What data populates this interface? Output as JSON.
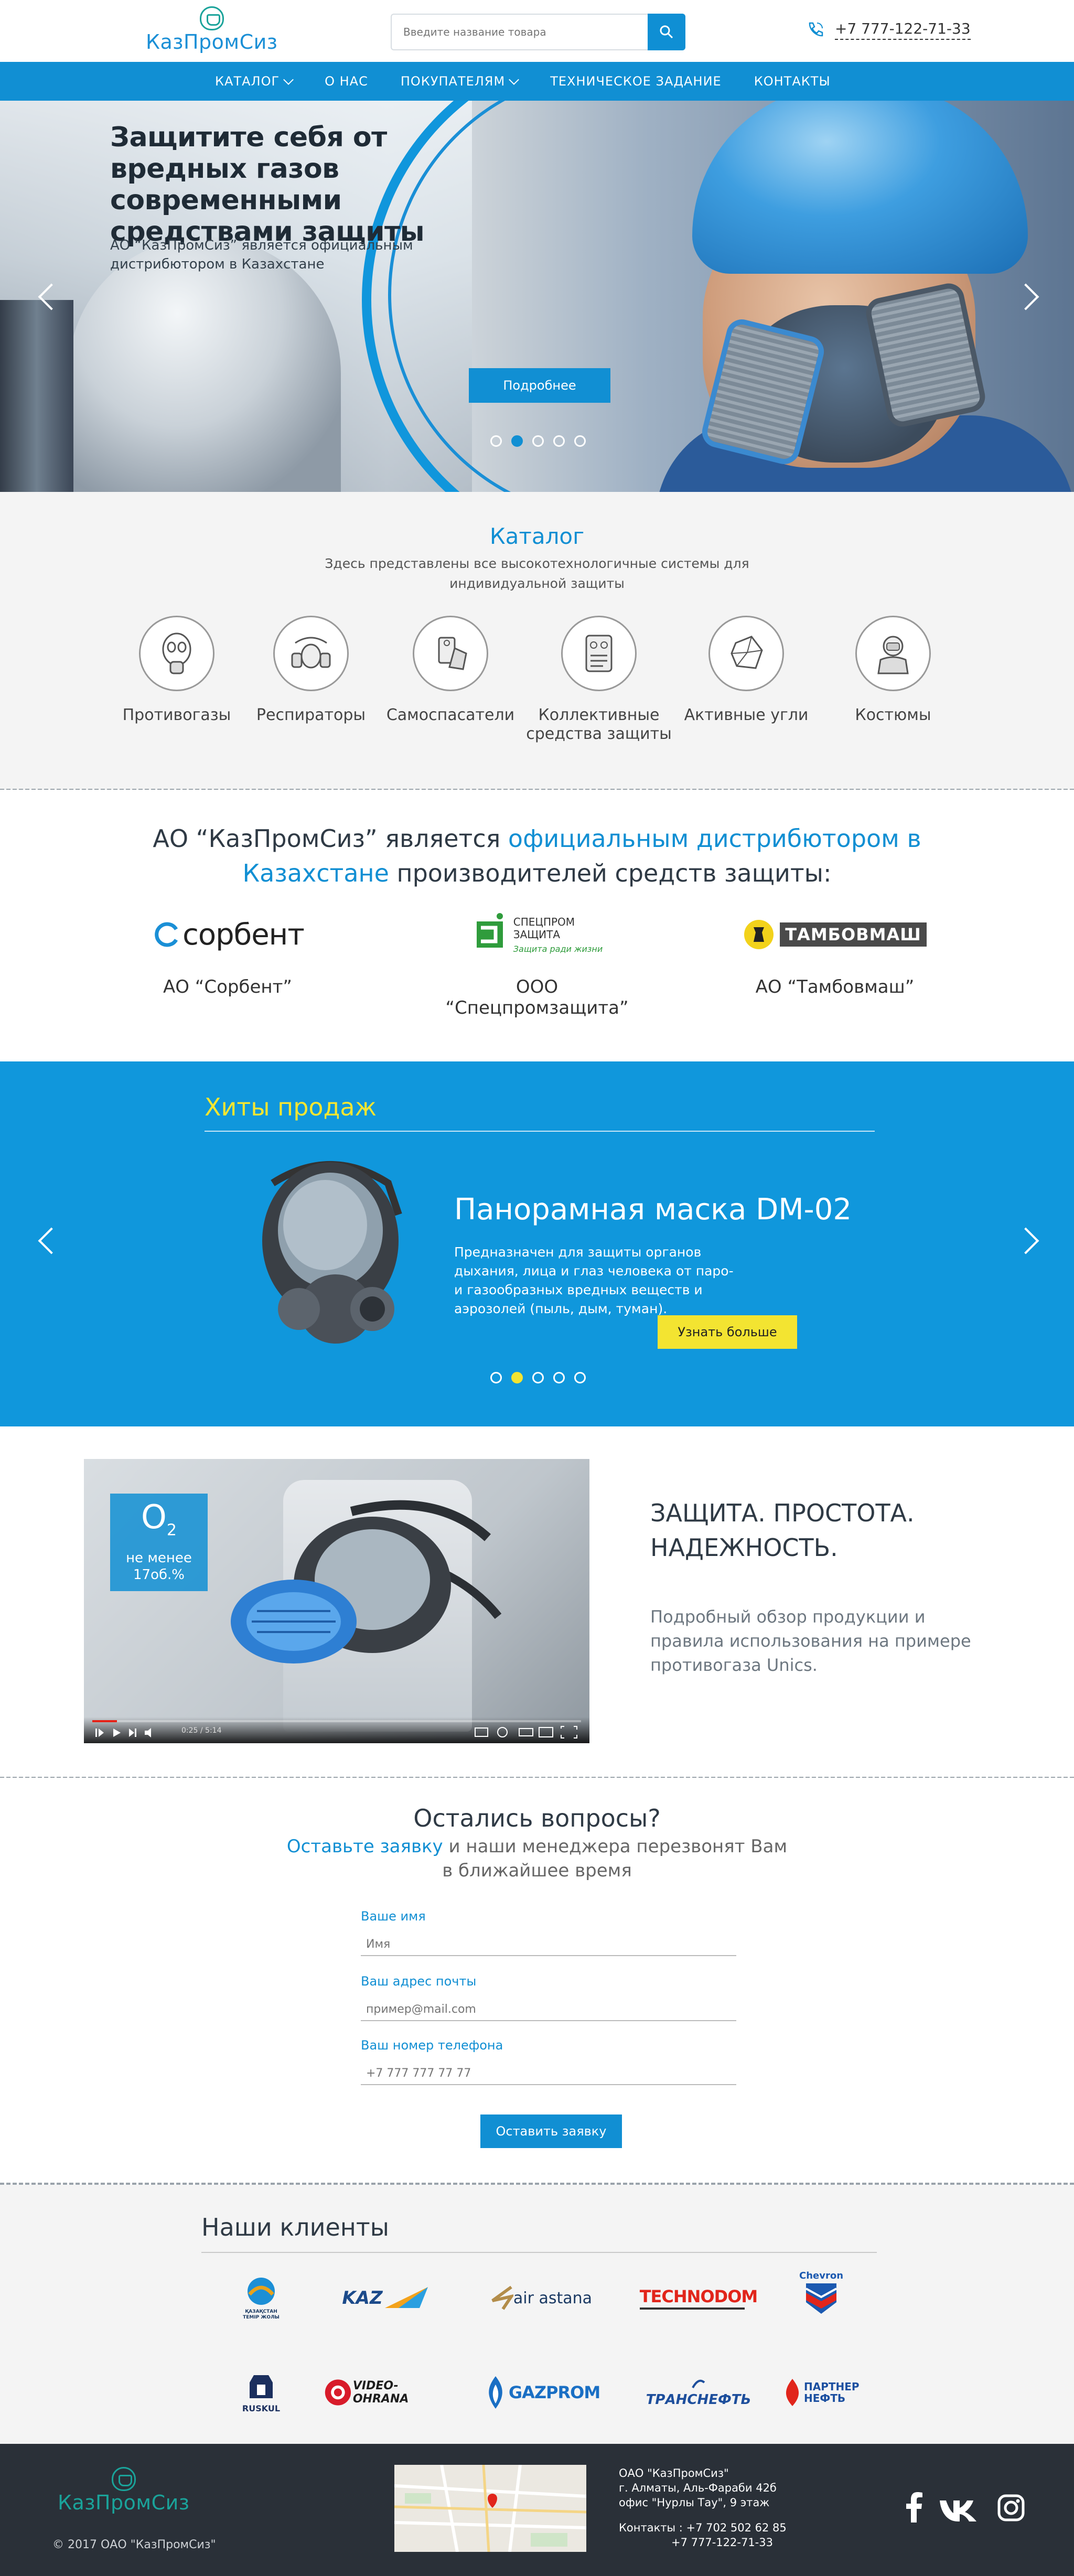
{
  "header": {
    "logo_text": "КазПромСиз",
    "search_placeholder": "Введите название товара",
    "phone": "+7 777-122-71-33"
  },
  "nav": {
    "items": [
      {
        "label": "КАТАЛОГ",
        "has_dropdown": true
      },
      {
        "label": "О НАС",
        "has_dropdown": false
      },
      {
        "label": "ПОКУПАТЕЛЯМ",
        "has_dropdown": true
      },
      {
        "label": "ТЕХНИЧЕСКОЕ ЗАДАНИЕ",
        "has_dropdown": false
      },
      {
        "label": "КОНТАКТЫ",
        "has_dropdown": false
      }
    ]
  },
  "hero": {
    "title": "Защитите себя от вредных газов современными средствами защиты",
    "subtitle": "АО “КазПромСиз” является официальным дистрибютором в Казахстане",
    "button": "Подробнее",
    "active_slide": 2,
    "slide_count": 5
  },
  "catalog": {
    "title": "Каталог",
    "subtitle": "Здесь представлены все высокотехнологичные системы для индивидуальной защиты",
    "items": [
      {
        "label": "Противогазы",
        "icon": "gas-mask-icon"
      },
      {
        "label": "Респираторы",
        "icon": "respirator-icon"
      },
      {
        "label": "Самоспасатели",
        "icon": "self-rescuer-icon"
      },
      {
        "label": "Коллективные средства защиты",
        "icon": "collective-protection-icon"
      },
      {
        "label": "Активные угли",
        "icon": "activated-carbon-icon"
      },
      {
        "label": "Костюмы",
        "icon": "suit-icon"
      }
    ]
  },
  "distributor": {
    "title_part1": "АО “КазПромСиз” является ",
    "title_highlight": "официальным дистрибютором в Казахстане",
    "title_part2": " производителей средств защиты:",
    "brands": [
      {
        "label": "АО “Сорбент”",
        "logo_text": "сорбент"
      },
      {
        "label": "ООО “Спецпромзащита”",
        "logo_text": "СПЕЦПРОМ ЗАЩИТА",
        "logo_sub": "Защита ради жизни"
      },
      {
        "label": "АО “Тамбовмаш”",
        "logo_text": "ТАМБОВМАШ"
      }
    ]
  },
  "hits": {
    "title": "Хиты продаж",
    "product_title": "Панорамная маска DM-02",
    "product_desc": "Предназначен для защиты органов дыхания, лица и глаз человека от паро- и газообразных вредных веществ и аэрозолей (пыль, дым, туман).",
    "button": "Узнать больше",
    "active_slide": 2,
    "slide_count": 5
  },
  "video": {
    "badge_o2": "O",
    "badge_sub": "2",
    "badge_line1": "не менее",
    "badge_line2": "17об.%",
    "time": "0:25 / 5:14",
    "heading_line1": "ЗАЩИТА. ПРОСТОТА.",
    "heading_line2": "НАДЕЖНОСТЬ.",
    "description": "Подробный обзор продукции и правила использования на примере противогаза Unics."
  },
  "form": {
    "title": "Остались вопросы?",
    "sub_link": "Оставьте заявку",
    "sub_rest": " и наши менеджера перезвонят Вам",
    "sub_line2": "в ближайшее время",
    "fields": [
      {
        "label": "Ваше имя",
        "placeholder": "Имя"
      },
      {
        "label": "Ваш адрес почты",
        "placeholder": "пример@mail.com"
      },
      {
        "label": "Ваш номер телефона",
        "placeholder": "+7 777 777 77 77"
      }
    ],
    "submit": "Оставить заявку"
  },
  "clients": {
    "title": "Наши клиенты",
    "logos": [
      {
        "name": "ҚАЗАҚСТАН ТЕМІР ЖОЛЫ",
        "color": "#e8a21b"
      },
      {
        "name": "KAZ",
        "color": "#1b4a8a"
      },
      {
        "name": "air astana",
        "color": "#1b3a63"
      },
      {
        "name": "TECHNODOM",
        "color": "#e1251b"
      },
      {
        "name": "Chevron",
        "color": "#1b59b0"
      },
      {
        "name": "RUSKUL",
        "color": "#1b2f5e"
      },
      {
        "name": "VIDEO-OHRANA",
        "color": "#d81b2a"
      },
      {
        "name": "GAZPROM",
        "color": "#1a6fc4"
      },
      {
        "name": "ТРАНСНЕФТЬ",
        "color": "#1d4e9c"
      },
      {
        "name": "ПАРТНЕР НЕФТЬ",
        "color": "#1b4fa0"
      }
    ]
  },
  "footer": {
    "logo_text": "КазПромСиз",
    "copyright": "© 2017 ОАО \"КазПромСиз\"",
    "company": "ОАО \"КазПромСиз\"",
    "address1": "г. Алматы, Аль-Фараби 42б",
    "address2": "офис \"Нурлы Тау\", 9 этаж",
    "contacts_label": "Контакты : +7 702 502 62 85",
    "contacts_phone2": "+7 777-122-71-33"
  },
  "colors": {
    "primary": "#118fd3",
    "accent": "#f3e431",
    "footer": "#2a3038"
  }
}
